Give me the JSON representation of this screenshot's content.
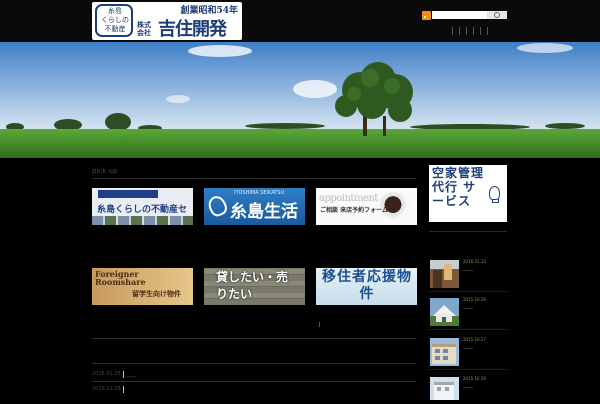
{
  "header": {
    "logo": {
      "emblem_lines": [
        "糸島",
        "くらしの",
        "不動産"
      ],
      "established": "創業昭和54年",
      "company_type_lines": [
        "株式",
        "会社"
      ],
      "company_name": "吉住開発"
    },
    "search": {
      "placeholder": ""
    },
    "icons": {
      "rss": "rss-icon",
      "search": "search-icon"
    }
  },
  "hero": {
    "slide_count": 3,
    "active_slide": 1,
    "colors": {
      "sky_top": "#3f7fc7",
      "sky_bottom": "#dbe7f3",
      "grass": "#4f9a31"
    }
  },
  "pickup": {
    "heading": "pick up",
    "banners": [
      {
        "label": "糸島くらしの不動産セレクト",
        "title_bar": ""
      },
      {
        "label": "糸島生活",
        "subtitle": "ITOSHIMA SEIKATSU",
        "footer": ""
      },
      {
        "label_en": "appointment",
        "label_jp": "ご相談 来店予約フォーム"
      },
      {
        "label_en": "Foreigner Roomshare",
        "label_jp": "留学生向け物件",
        "footer": ""
      },
      {
        "label": "貸したい・売りたい"
      },
      {
        "label": "移住者応援物件"
      }
    ]
  },
  "news": [
    {
      "date": "2016.01.25",
      "text": "____"
    },
    {
      "date": "2015.12.28",
      "text": ""
    }
  ],
  "sidebar": {
    "banner": "空家管理 代行 サービス",
    "posts": [
      {
        "date": "2016.01.13"
      },
      {
        "date": "2015.10.26"
      },
      {
        "date": "2015.10.27"
      },
      {
        "date": "2015.10.26"
      }
    ]
  }
}
